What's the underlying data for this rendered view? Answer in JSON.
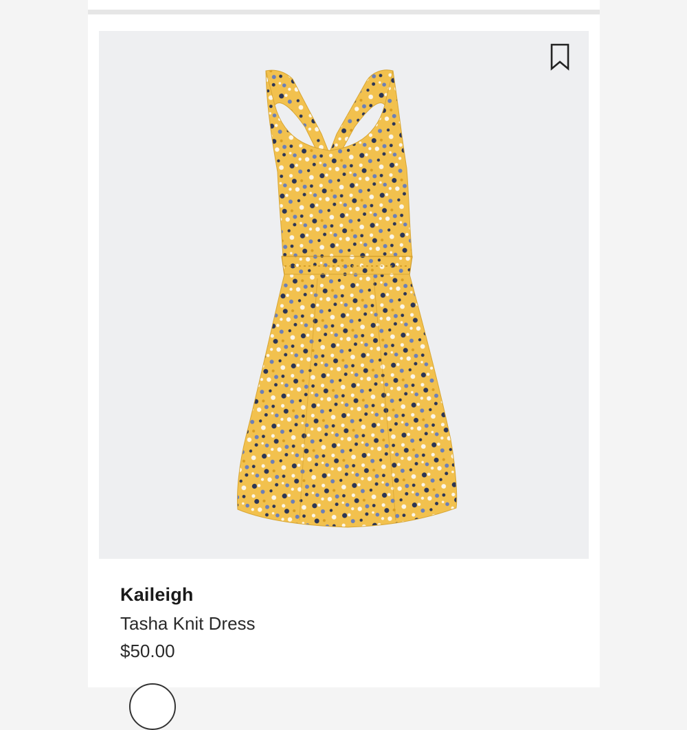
{
  "product": {
    "brand": "Kaileigh",
    "name": "Tasha Knit Dress",
    "price": "$50.00"
  },
  "icons": {
    "save": "bookmark-icon"
  },
  "colors": {
    "dress_base": "#f2c14e",
    "print_navy": "#2b3557",
    "print_blue": "#6b7fb8",
    "print_white": "#fbf6ea",
    "print_dark_yellow": "#d99d22",
    "panel_background": "#eeeff1"
  }
}
